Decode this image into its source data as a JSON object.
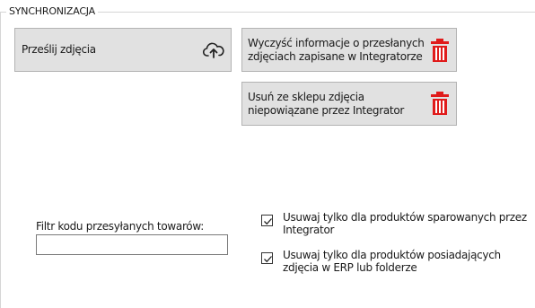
{
  "group": {
    "title": "SYNCHRONIZACJA"
  },
  "buttons": {
    "upload": {
      "label": "Prześlij zdjęcia",
      "icon": "cloud-upload-icon"
    },
    "clear": {
      "label": "Wyczyść informacje o przesłanych zdjęciach zapisane w Integratorze",
      "icon": "trash-icon"
    },
    "remove": {
      "label": "Usuń ze sklepu zdjęcia niepowiązane przez Integrator",
      "icon": "trash-icon"
    }
  },
  "filter": {
    "label": "Filtr kodu przesyłanych towarów:",
    "value": ""
  },
  "checkboxes": [
    {
      "label": "Usuwaj tylko dla produktów sparowanych przez Integrator",
      "checked": true
    },
    {
      "label": "Usuwaj tylko dla produktów posiadających zdjęcia w ERP lub folderze",
      "checked": true
    }
  ],
  "colors": {
    "trash": "#e01b1b",
    "button_bg": "#e1e1e1"
  }
}
